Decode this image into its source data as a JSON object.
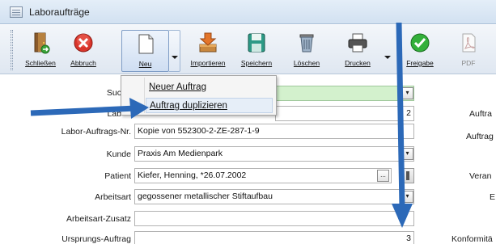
{
  "window": {
    "title": "Laboraufträge"
  },
  "toolbar": {
    "buttons": [
      {
        "label": "Schließen"
      },
      {
        "label": "Abbruch"
      },
      {
        "label": "Neu"
      },
      {
        "label": "Importieren"
      },
      {
        "label": "Speichern"
      },
      {
        "label": "Löschen"
      },
      {
        "label": "Drucken"
      },
      {
        "label": "Freigabe"
      },
      {
        "label": "PDF"
      }
    ]
  },
  "menu": {
    "items": [
      {
        "label": "Neuer Auftrag"
      },
      {
        "label": "Auftrag duplizieren"
      }
    ]
  },
  "form": {
    "search_label": "Suc",
    "lab_label": "Lab",
    "lab_value_tail": "2",
    "auftrags_nr_label": "Labor-Auftrags-Nr.",
    "auftrags_nr_value": "Kopie von 552300-2-ZE-287-1-9",
    "kunde_label": "Kunde",
    "kunde_value": "Praxis Am Medienpark",
    "patient_label": "Patient",
    "patient_value": "Kiefer, Henning, *26.07.2002",
    "patient_btn": "...",
    "arbeitsart_label": "Arbeitsart",
    "arbeitsart_value": "gegossener metallischer Stiftaufbau",
    "zusatz_label": "Arbeitsart-Zusatz",
    "zusatz_value": "",
    "ursprung_label": "Ursprungs-Auftrag",
    "ursprung_value": "3"
  },
  "right_labels": {
    "r1": "Auftra",
    "r2": "Auftrag",
    "r3": "Veran",
    "r4": "E",
    "r5": "Konformitä"
  },
  "annotations": {
    "arrow_color": "#2c69b8"
  }
}
